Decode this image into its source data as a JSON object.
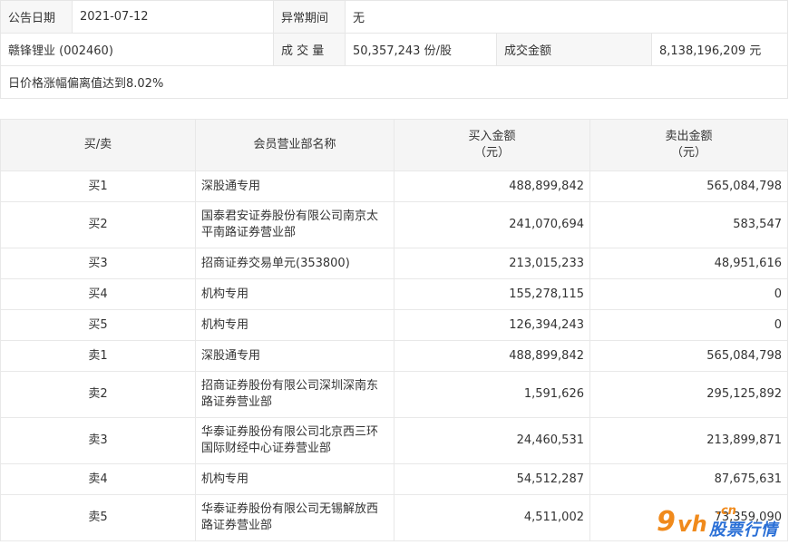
{
  "info": {
    "announce_date_label": "公告日期",
    "announce_date_value": "2021-07-12",
    "abnormal_period_label": "异常期间",
    "abnormal_period_value": "无",
    "stock_name": "赣锋锂业 (002460)",
    "volume_label": "成 交 量",
    "volume_value": "50,357,243 份/股",
    "amount_label": "成交金额",
    "amount_value": "8,138,196,209 元",
    "note": "日价格涨幅偏离值达到8.02%"
  },
  "table": {
    "headers": {
      "side": "买/卖",
      "name": "会员营业部名称",
      "buy_line1": "买入金额",
      "buy_line2": "（元）",
      "sell_line1": "卖出金额",
      "sell_line2": "（元）"
    },
    "rows": [
      {
        "side": "买1",
        "name": "深股通专用",
        "buy": "488,899,842",
        "sell": "565,084,798"
      },
      {
        "side": "买2",
        "name": "国泰君安证券股份有限公司南京太平南路证券营业部",
        "buy": "241,070,694",
        "sell": "583,547"
      },
      {
        "side": "买3",
        "name": "招商证券交易单元(353800)",
        "buy": "213,015,233",
        "sell": "48,951,616"
      },
      {
        "side": "买4",
        "name": "机构专用",
        "buy": "155,278,115",
        "sell": "0"
      },
      {
        "side": "买5",
        "name": "机构专用",
        "buy": "126,394,243",
        "sell": "0"
      },
      {
        "side": "卖1",
        "name": "深股通专用",
        "buy": "488,899,842",
        "sell": "565,084,798"
      },
      {
        "side": "卖2",
        "name": "招商证券股份有限公司深圳深南东路证券营业部",
        "buy": "1,591,626",
        "sell": "295,125,892"
      },
      {
        "side": "卖3",
        "name": "华泰证券股份有限公司北京西三环国际财经中心证券营业部",
        "buy": "24,460,531",
        "sell": "213,899,871"
      },
      {
        "side": "卖4",
        "name": "机构专用",
        "buy": "54,512,287",
        "sell": "87,675,631"
      },
      {
        "side": "卖5",
        "name": "华泰证券股份有限公司无锡解放西路证券营业部",
        "buy": "4,511,002",
        "sell": "73,359,090"
      }
    ]
  },
  "watermark": {
    "nine": "9",
    "vh": "vh",
    "cn": ".cn",
    "text": "股票行情",
    "color_orange": "#f08a1c",
    "color_blue": "#2a6fd6"
  }
}
